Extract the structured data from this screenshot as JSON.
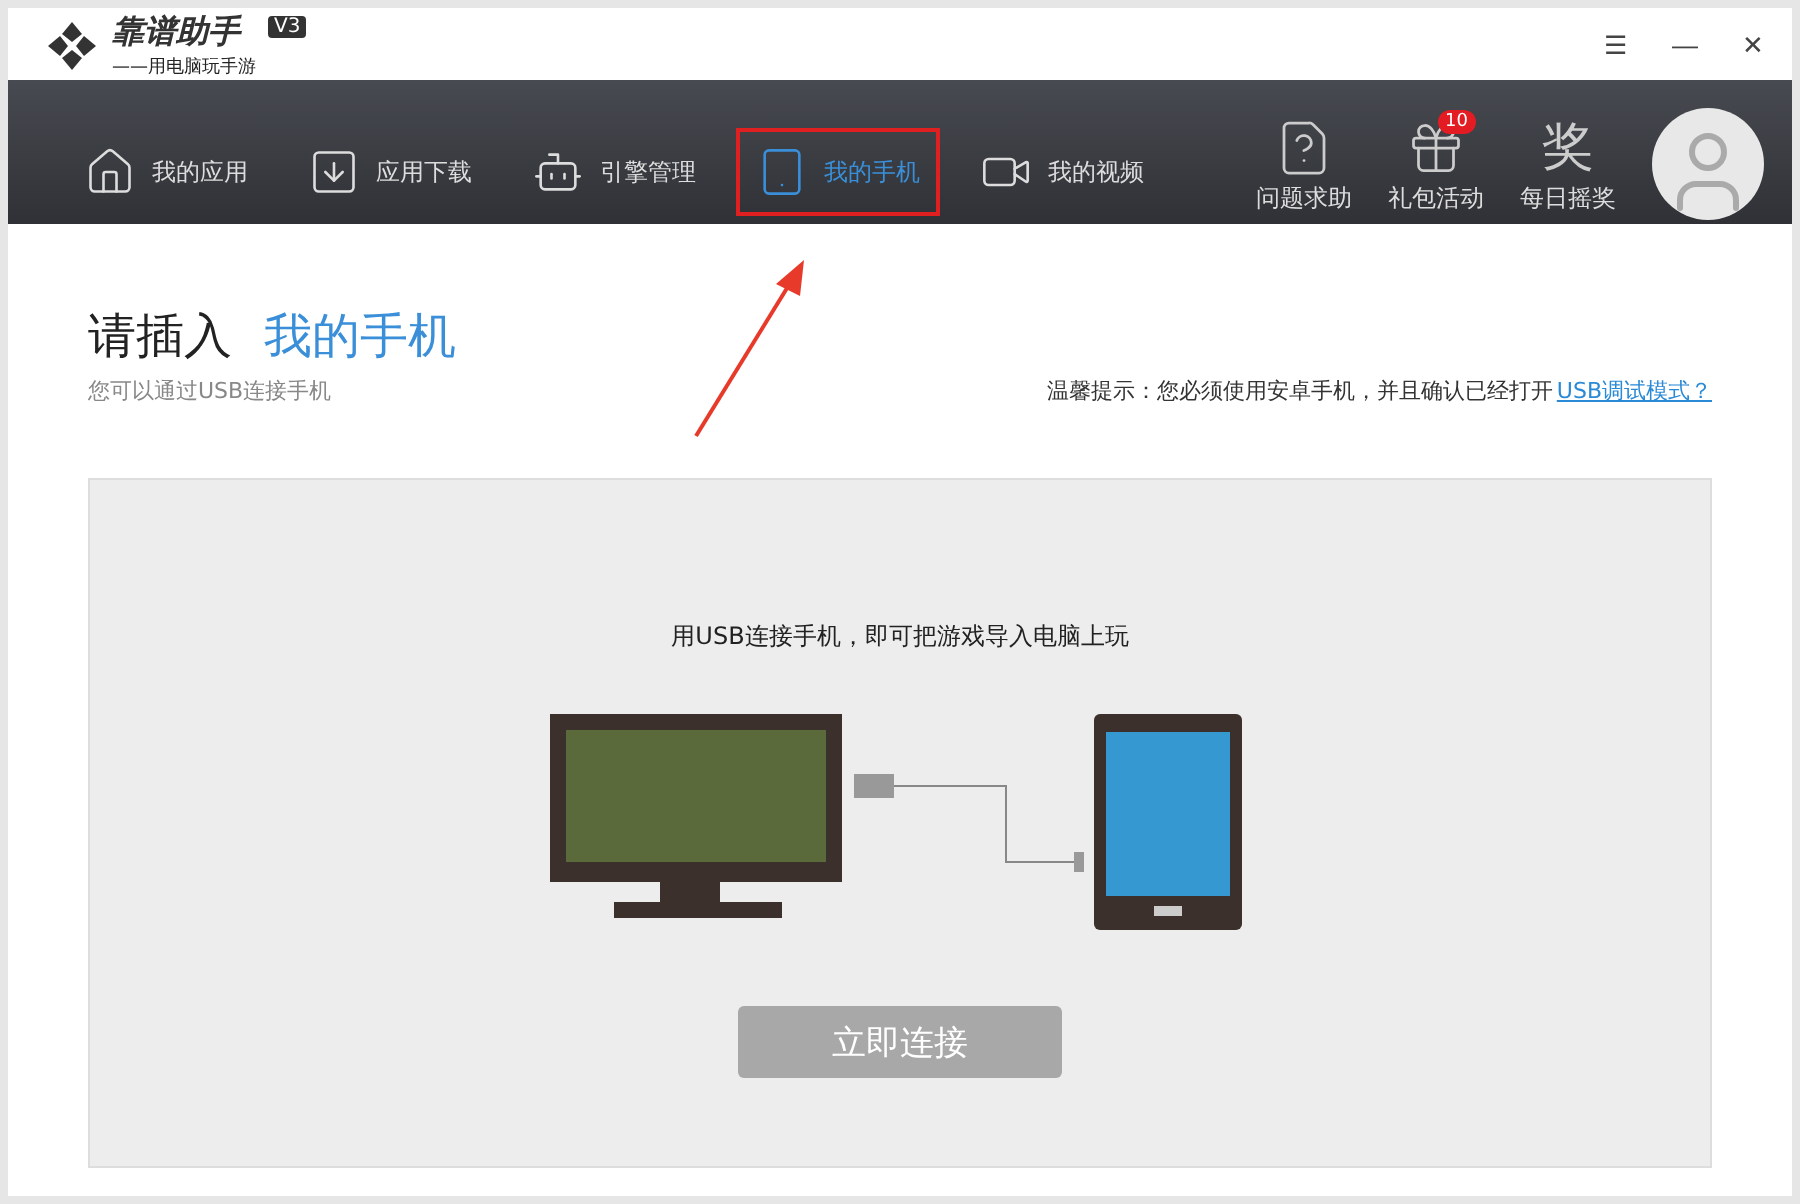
{
  "app": {
    "name": "靠谱助手",
    "version": "V3",
    "slogan": "——用电脑玩手游"
  },
  "window_controls": [
    "☰",
    "—",
    "✕"
  ],
  "nav": [
    {
      "label": "我的应用",
      "kind": "home",
      "selected": false
    },
    {
      "label": "应用下载",
      "kind": "download",
      "selected": false
    },
    {
      "label": "引擎管理",
      "kind": "android",
      "selected": false
    },
    {
      "label": "我的手机",
      "kind": "phone",
      "selected": true
    },
    {
      "label": "我的视频",
      "kind": "video",
      "selected": false
    }
  ],
  "tools": [
    {
      "label": "问题求助",
      "kind": "help"
    },
    {
      "label": "礼包活动",
      "kind": "gift",
      "badge": "10"
    },
    {
      "label": "每日摇奖",
      "kind": "prize",
      "glyph": "奖"
    }
  ],
  "heading": {
    "prefix": "请插入",
    "highlight": "我的手机",
    "subtitle": "您可以通过USB连接手机"
  },
  "notice": {
    "text": "温馨提示：您必须使用安卓手机，并且确认已经打开",
    "link": "USB调试模式？"
  },
  "panel": {
    "caption": "用USB连接手机，即可把游戏导入电脑上玩",
    "button": "立即连接"
  }
}
